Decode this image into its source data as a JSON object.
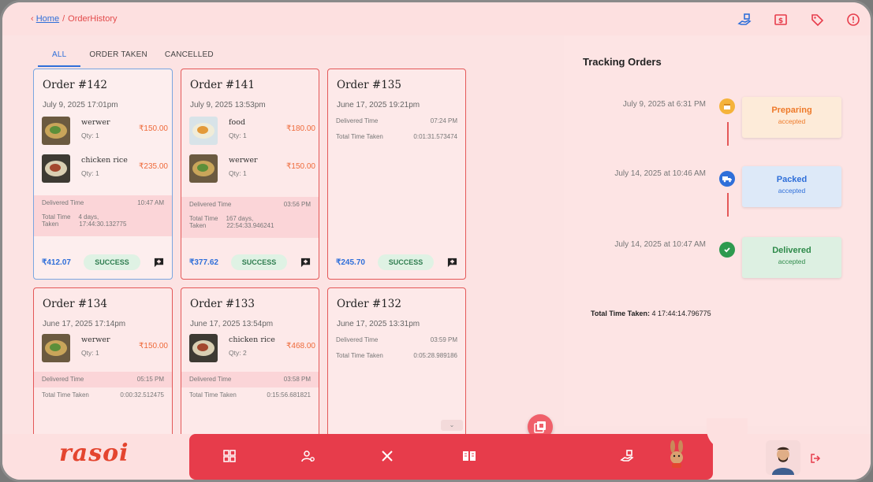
{
  "breadcrumb": {
    "home": "Home",
    "separator": "/",
    "current": "OrderHistory"
  },
  "top_icons": [
    "hand-delivery-icon",
    "dollar-note-icon",
    "tag-icon",
    "alert-icon"
  ],
  "tabs": [
    {
      "label": "ALL",
      "active": true
    },
    {
      "label": "ORDER TAKEN"
    },
    {
      "label": "CANCELLED"
    }
  ],
  "orders": [
    {
      "title": "Order #142",
      "date": "July 9, 2025 17:01pm",
      "items": [
        {
          "name": "werwer",
          "qty": "Qty: 1",
          "price": "₹150.00"
        },
        {
          "name": "chicken rice",
          "qty": "Qty: 1",
          "price": "₹235.00"
        }
      ],
      "delivered_label": "Delivered Time",
      "delivered_time": "10:47 AM",
      "total_label_1": "Total Time",
      "total_label_2": "Taken",
      "total_1": "4 days,",
      "total_2": "17:44:30.132775",
      "amount": "₹412.07",
      "status": "SUCCESS"
    },
    {
      "title": "Order #141",
      "date": "July 9, 2025 13:53pm",
      "items": [
        {
          "name": "food",
          "qty": "Qty: 1",
          "price": "₹180.00"
        },
        {
          "name": "werwer",
          "qty": "Qty: 1",
          "price": "₹150.00"
        }
      ],
      "delivered_label": "Delivered Time",
      "delivered_time": "03:56 PM",
      "total_label_1": "Total Time",
      "total_label_2": "Taken",
      "total_1": "167 days,",
      "total_2": "22:54:33.946241",
      "amount": "₹377.62",
      "status": "SUCCESS"
    },
    {
      "title": "Order #135",
      "date": "June 17, 2025 19:21pm",
      "delivered_label": "Delivered Time",
      "delivered_time": "07:24 PM",
      "total_label": "Total Time Taken",
      "total": "0:01:31.573474",
      "amount": "₹245.70",
      "status": "SUCCESS"
    },
    {
      "title": "Order #134",
      "date": "June 17, 2025 17:14pm",
      "items": [
        {
          "name": "werwer",
          "qty": "Qty: 1",
          "price": "₹150.00"
        }
      ],
      "delivered_label": "Delivered Time",
      "delivered_time": "05:15 PM",
      "total_label": "Total Time Taken",
      "total": "0:00:32.512475"
    },
    {
      "title": "Order #133",
      "date": "June 17, 2025 13:54pm",
      "items": [
        {
          "name": "chicken rice",
          "qty": "Qty: 2",
          "price": "₹468.00"
        }
      ],
      "delivered_label": "Delivered Time",
      "delivered_time": "03:58 PM",
      "total_label": "Total Time Taken",
      "total": "0:15:56.681821"
    },
    {
      "title": "Order #132",
      "date": "June 17, 2025 13:31pm",
      "delivered_label": "Delivered Time",
      "delivered_time": "03:59 PM",
      "total_label": "Total Time Taken",
      "total": "0:05:28.989186"
    }
  ],
  "tracking": {
    "title": "Tracking Orders",
    "steps": [
      {
        "date": "July 9, 2025 at 6:31 PM",
        "status": "Preparing",
        "sub": "accepted",
        "icon": "box-icon",
        "color": "#ee7a2a"
      },
      {
        "date": "July 14, 2025 at 10:46 AM",
        "status": "Packed",
        "sub": "accepted",
        "icon": "truck-icon",
        "color": "#2f6fd9"
      },
      {
        "date": "July 14, 2025 at 10:47 AM",
        "status": "Delivered",
        "sub": "accepted",
        "icon": "check-icon",
        "color": "#2e9a4f"
      }
    ],
    "total_label": "Total Time Taken:",
    "total_value": "4 17:44:14.796775"
  },
  "logo_text": "rasoi",
  "nav_icons": [
    "dashboard-icon",
    "user-settings-icon",
    "utensils-icon",
    "menu-book-icon",
    "hand-delivery-icon",
    "mascot-icon"
  ],
  "colors": {
    "accent": "#e73c4b",
    "link": "#2f6fd9",
    "price": "#ee6a3a",
    "success": "#2e7d4f"
  }
}
